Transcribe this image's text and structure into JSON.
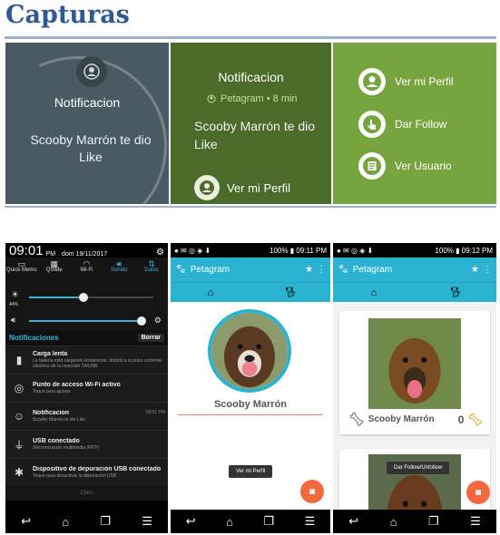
{
  "heading": "Capturas",
  "wear1": {
    "title": "Notificacion",
    "body": "Scooby Marrón te dio Like"
  },
  "wear2": {
    "title": "Notificacion",
    "meta": "Petagram • 8 min",
    "body": "Scooby Marrón te dio Like",
    "action": "Ver mi Perfil"
  },
  "wear3": {
    "items": [
      "Ver mi Perfil",
      "Dar Follow",
      "Ver Usuario"
    ]
  },
  "phone1": {
    "clock": "09:01",
    "ampm": "PM",
    "date": "dom 19/11/2017",
    "quick": [
      "Quick Memo",
      "QSlide",
      "Wi-Fi",
      "Sonido",
      "Datos"
    ],
    "brightness": "44%",
    "brightness_level": 0.44,
    "volume_level": 0.98,
    "notif_header": "Notificaciones",
    "clear_button": "Borrar",
    "notifications": [
      {
        "title": "Carga lenta",
        "sub": "La batería está cargando lentamente, debido a la poca corriente eléctrica de la conexión TA/USB.",
        "time": ""
      },
      {
        "title": "Punto de acceso Wi-Fi activo",
        "sub": "Toque para ajustar",
        "time": ""
      },
      {
        "title": "Notificacion",
        "sub": "Scooby Marrón te dio Like",
        "time": "09:01 PM"
      },
      {
        "title": "USB conectado",
        "sub": "Sincronización multimedia (MTP)",
        "time": ""
      },
      {
        "title": "Dispositivo de depuración USB conectado",
        "sub": "Toque para desactivar la depuración USB",
        "time": ""
      }
    ],
    "clear_text": "Claro"
  },
  "phone2": {
    "status_time": "09:11 PM",
    "battery": "100%",
    "app_title": "Petagram",
    "name": "Scooby Marrón",
    "toast": "Ver mi Perfil"
  },
  "phone3": {
    "status_time": "09:12 PM",
    "battery": "100%",
    "app_title": "Petagram",
    "name": "Scooby Marrón",
    "likes": "0",
    "toast": "Dar Follow/Unfollow"
  },
  "colors": {
    "accent": "#2ab2d1",
    "fab": "#f4683f",
    "wear_gray": "#4a5a63",
    "wear_dark_green": "#4c6b2a",
    "wear_green": "#76a43e",
    "heading": "#2f5897"
  }
}
